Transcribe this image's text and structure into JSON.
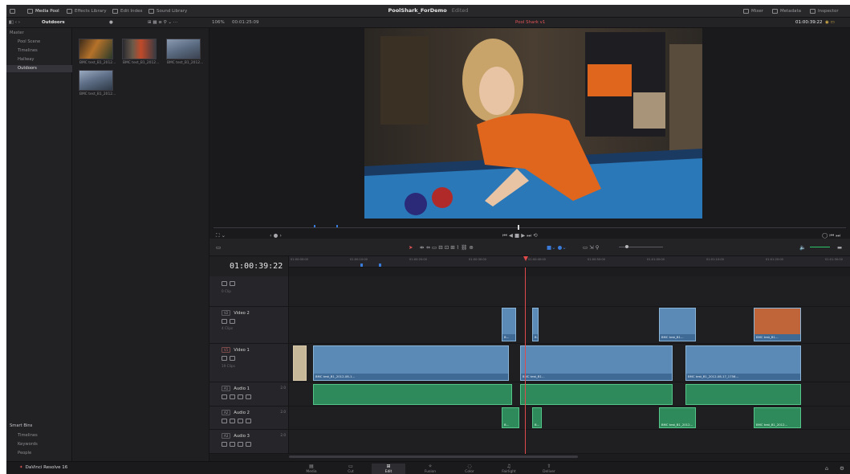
{
  "topbar": {
    "media_pool": "Media Pool",
    "effects_library": "Effects Library",
    "edit_index": "Edit Index",
    "sound_library": "Sound Library",
    "project_title": "PoolShark_ForDemo",
    "project_status": "Edited",
    "mixer": "Mixer",
    "metadata": "Metadata",
    "inspector": "Inspector"
  },
  "subbar": {
    "bin_name": "Outdoors",
    "zoom": "106%",
    "source_timecode": "00:01:25:09",
    "timeline_name": "Pool Shark v1",
    "record_timecode": "01:00:39:22"
  },
  "bins": {
    "tree": [
      "Master",
      "Pool Scene",
      "Timelines",
      "Hallway",
      "Outdoors"
    ],
    "selected": "Outdoors",
    "clips": [
      "BMC test_B1_2012...",
      "BMC test_B1_2012...",
      "BMC test_B1_2012...",
      "BMC test_B1_2012..."
    ],
    "smart_bins_title": "Smart Bins",
    "smart_bins": [
      "Timelines",
      "Keywords",
      "People"
    ]
  },
  "timeline": {
    "timecode": "01:00:39:22",
    "ruler_ticks": [
      "01:00:00:00",
      "01:00:10:00",
      "01:00:20:00",
      "01:00:30:00",
      "01:00:40:00",
      "01:00:50:00",
      "01:01:00:00",
      "01:01:10:00",
      "01:01:20:00",
      "01:01:30:00"
    ],
    "tracks": {
      "v3_sub": "0 Clip",
      "v2_tag": "V2",
      "v2_name": "Video 2",
      "v2_sub": "4 Clips",
      "v1_tag": "V1",
      "v1_name": "Video 1",
      "v1_sub": "19 Clips",
      "a1_tag": "A1",
      "a1_name": "Audio 1",
      "a1_ch": "2.0",
      "a2_tag": "A2",
      "a2_name": "Audio 2",
      "a2_ch": "2.0",
      "a3_tag": "A3",
      "a3_name": "Audio 3",
      "a3_ch": "2.0"
    },
    "clip_labels": {
      "v1_main": "BMC test_B1...",
      "v1_long": "BMC test_B1_2012-08-1...",
      "v1_right": "BMC test_B1_2012-08-17_1756...",
      "v2": "BMC test_B1...",
      "a_short": "BMC test_B1_2012...",
      "a_tiny": "B..."
    }
  },
  "page_nav": {
    "app_name": "DaVinci Resolve 16",
    "pages": [
      "Media",
      "Cut",
      "Edit",
      "Fusion",
      "Color",
      "Fairlight",
      "Deliver"
    ],
    "active": "Edit"
  }
}
